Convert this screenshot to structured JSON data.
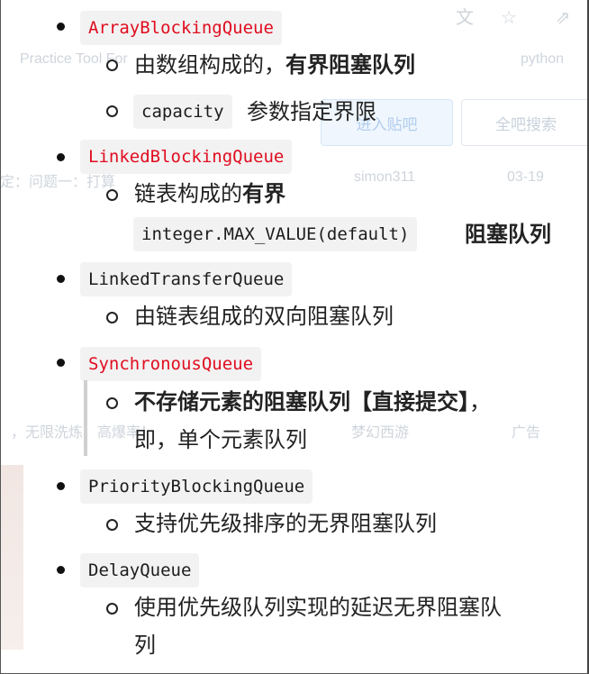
{
  "background": {
    "practice_text": "Practice Tool For",
    "python_text": "python",
    "enter_bar_button": "进入贴吧",
    "search_bar_button": "全吧搜索",
    "thread_prefix": "定：问题一：打算",
    "author": "simon311",
    "time": "03-19",
    "ad_left": "，无限洗炼，高爆率！",
    "ad_mid": "梦幻西游",
    "ad_right": "广告"
  },
  "queues": [
    {
      "name": "ArrayBlockingQueue",
      "name_color": "#e00d1f",
      "sub1_plain": "由数组构成的，",
      "sub1_bold": "有界阻塞队列",
      "sub2_code": "capacity",
      "sub2_text": "参数指定界限"
    },
    {
      "name": "LinkedBlockingQueue",
      "name_color": "#e00d1f",
      "sub1_plain": "链表构成的",
      "sub1_bold": "有界",
      "sub2_code": "integer.MAX_VALUE(default)",
      "sub2_bold": "阻塞队列"
    },
    {
      "name": "LinkedTransferQueue",
      "sub1_plain": "由链表组成的双向阻塞队列"
    },
    {
      "name": "SynchronousQueue",
      "name_color": "#e00d1f",
      "sub1_bold": "不存储元素的阻塞队列【直接提交】",
      "sub1_tail": "，",
      "sub1_line2": "即，单个元素队列"
    },
    {
      "name": "PriorityBlockingQueue",
      "sub1_plain": "支持优先级排序的无界阻塞队列"
    },
    {
      "name": "DelayQueue",
      "sub1_plain": "使用优先级队列实现的延迟无界阻塞队",
      "sub1_line2": "列"
    }
  ]
}
